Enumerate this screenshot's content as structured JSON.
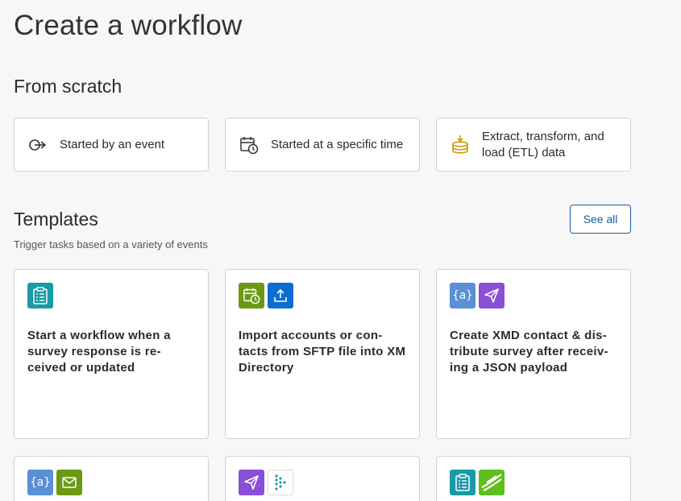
{
  "page": {
    "title": "Create a workflow"
  },
  "scratch": {
    "heading": "From scratch",
    "cards": [
      {
        "label": "Started by an event",
        "icon": "event-arrow-icon"
      },
      {
        "label": "Started at a specific time",
        "icon": "calendar-clock-icon"
      },
      {
        "label": "Extract, transform, and load (ETL) data",
        "icon": "database-download-icon"
      }
    ]
  },
  "templates": {
    "heading": "Templates",
    "subtitle": "Trigger tasks based on a variety of events",
    "see_all_label": "See all",
    "cards": [
      {
        "title": "Start a workflow when a survey response is re-ceived or updated",
        "icons": [
          "survey-clipboard-icon"
        ]
      },
      {
        "title": "Import accounts or con-tacts from SFTP file into XM Directory",
        "icons": [
          "calendar-clock-icon",
          "upload-icon"
        ]
      },
      {
        "title": "Create XMD contact & dis-tribute survey after receiv-ing a JSON payload",
        "icons": [
          "json-braces-icon",
          "send-plane-icon"
        ]
      },
      {
        "title": "",
        "icons": [
          "json-braces-icon",
          "email-icon"
        ]
      },
      {
        "title": "",
        "icons": [
          "send-plane-icon",
          "zendesk-like-icon"
        ]
      },
      {
        "title": "",
        "icons": [
          "survey-clipboard-icon",
          "brand-swoosh-icon"
        ]
      }
    ]
  },
  "colors": {
    "teal": "#1a9aa6",
    "olive": "#6b9a12",
    "blue": "#0a6ed1",
    "json_blue": "#5b8fd6",
    "purple": "#8a4fd6",
    "green_swoosh": "#5fbf1e",
    "primary": "#1a5aa6"
  }
}
